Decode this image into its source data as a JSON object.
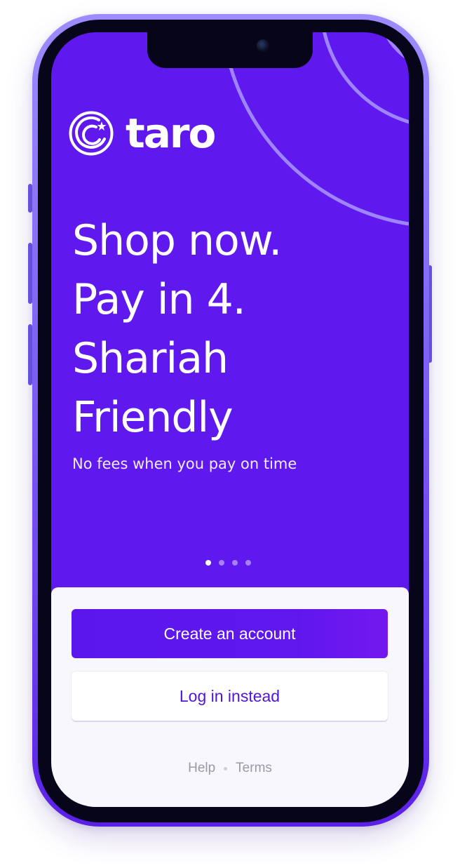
{
  "brand": {
    "name": "taro",
    "logo_icon": "crescent-star-logo-icon"
  },
  "hero": {
    "headline_lines": [
      "Shop now.",
      "Pay in 4.",
      "Shariah",
      "Friendly"
    ],
    "subtitle": "No fees when you pay on time",
    "background_color": "#5f18ee"
  },
  "pager": {
    "total": 4,
    "active_index": 0
  },
  "actions": {
    "create_account_label": "Create an account",
    "login_label": "Log in instead"
  },
  "footer": {
    "help_label": "Help",
    "terms_label": "Terms"
  },
  "colors": {
    "primary": "#5b16ee",
    "login_text": "#5314d6",
    "sheet_bg": "#f8f7fd"
  }
}
